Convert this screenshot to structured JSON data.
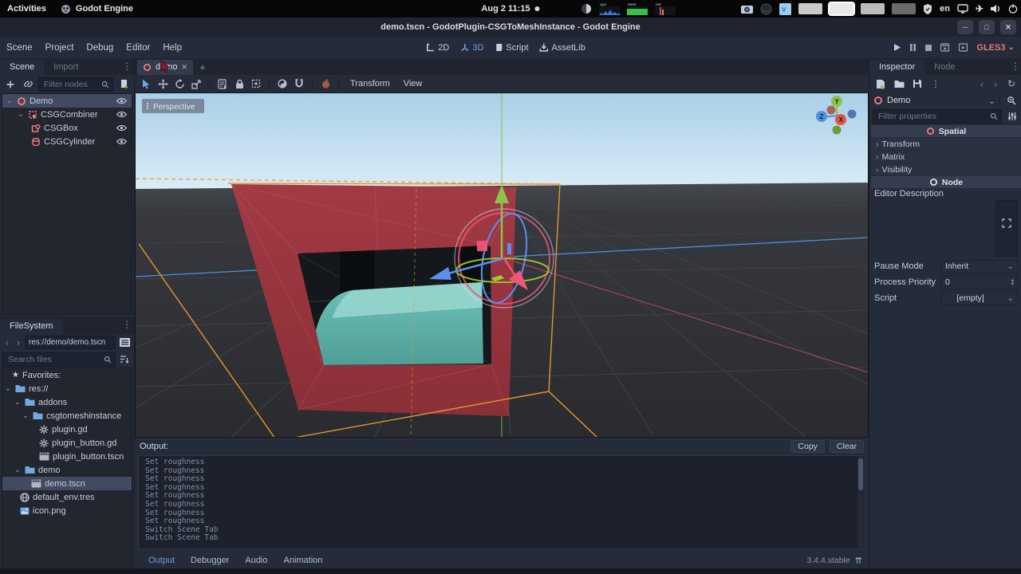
{
  "topbar": {
    "activities": "Activities",
    "app": "Godot Engine",
    "clock": "Aug 2 11:15",
    "lang": "en",
    "monitor": {
      "cpu": "cpu",
      "mem": "mem",
      "net": "net"
    }
  },
  "titlebar": {
    "title": "demo.tscn - GodotPlugin-CSGToMeshInstance - Godot Engine"
  },
  "menubar": {
    "menus": [
      "Scene",
      "Project",
      "Debug",
      "Editor",
      "Help"
    ],
    "workspaces": [
      "2D",
      "3D",
      "Script",
      "AssetLib"
    ],
    "renderer": "GLES3"
  },
  "scene_dock": {
    "tabs": [
      "Scene",
      "Import"
    ],
    "filter_placeholder": "Filter nodes",
    "nodes": [
      "Demo",
      "CSGCombiner",
      "CSGBox",
      "CSGCylinder"
    ]
  },
  "filesystem": {
    "title": "FileSystem",
    "path": "res://demo/demo.tscn",
    "search_placeholder": "Search files",
    "items": [
      "Favorites:",
      "res://",
      "addons",
      "csgtomeshinstance",
      "plugin.gd",
      "plugin_button.gd",
      "plugin_button.tscn",
      "demo",
      "demo.tscn",
      "default_env.tres",
      "icon.png"
    ]
  },
  "viewport": {
    "scene_tab": "demo",
    "perspective": "Perspective",
    "transform_menu": "Transform",
    "view_menu": "View",
    "nav_axes": {
      "x": "X",
      "y": "Y",
      "z": "Z"
    }
  },
  "output": {
    "title": "Output:",
    "copy": "Copy",
    "clear": "Clear",
    "lines": [
      "Set roughness",
      "Set roughness",
      "Set roughness",
      "Set roughness",
      "Set roughness",
      "Set roughness",
      "Set roughness",
      "Set roughness",
      "Switch Scene Tab",
      "Switch Scene Tab"
    ],
    "tabs": [
      "Output",
      "Debugger",
      "Audio",
      "Animation"
    ],
    "version": "3.4.4.stable"
  },
  "inspector": {
    "tabs": [
      "Inspector",
      "Node"
    ],
    "node_name": "Demo",
    "filter_placeholder": "Filter properties",
    "spatial_header": "Spatial",
    "groups": [
      "Transform",
      "Matrix",
      "Visibility"
    ],
    "node_header": "Node",
    "editor_description_label": "Editor Description",
    "properties": [
      {
        "label": "Pause Mode",
        "value": "Inherit"
      },
      {
        "label": "Process Priority",
        "value": "0"
      },
      {
        "label": "Script",
        "value": "[empty]"
      }
    ]
  },
  "icons": {
    "dots": "⋮",
    "back": "‹",
    "forward": "›",
    "chevron_down": "⌄",
    "chevron_right": "›",
    "close": "✕",
    "minimize": "─",
    "maximize": "□",
    "history": "↻",
    "airplane": "✈",
    "plus": "+",
    "star": "★",
    "spin_up": "▴",
    "spin_down": "▾",
    "expand_bottom": "⇈"
  },
  "colors": {
    "accent": "#699ce8",
    "node3d": "#fc7f7f",
    "renderer": "#e07a7a",
    "axis_x": "#f0557a",
    "axis_y": "#8bc34a",
    "axis_z": "#5b8ef0",
    "selection_box": "#e8952e",
    "csg_wall": "#9b3740",
    "csg_mesh": "#6fc2b8"
  }
}
